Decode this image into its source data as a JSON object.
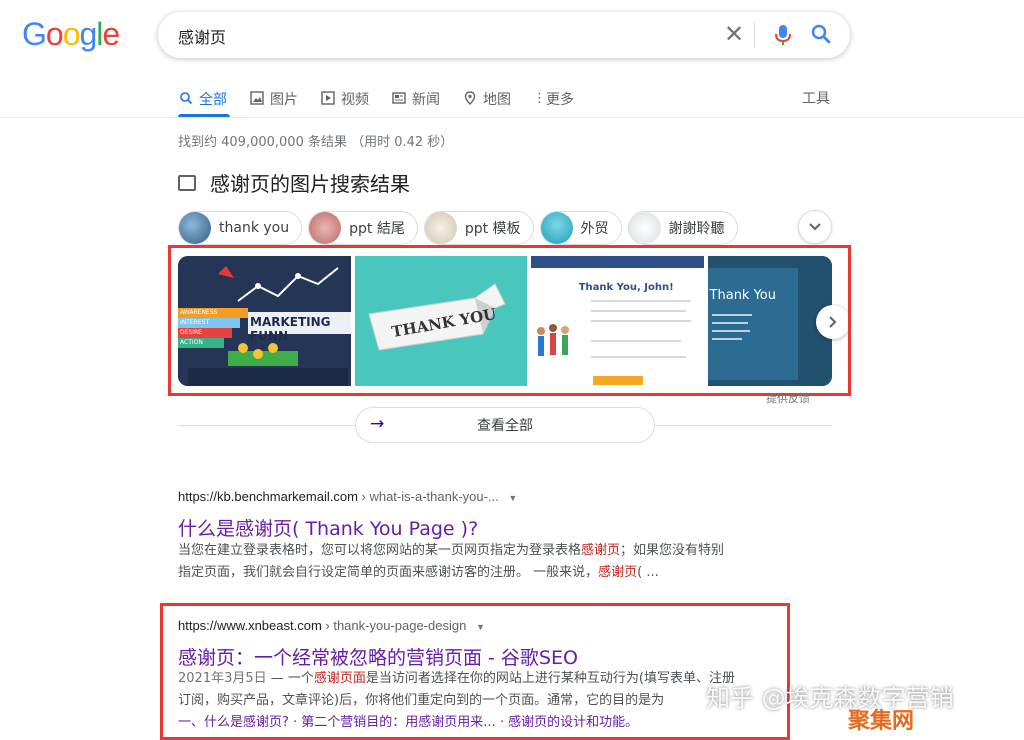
{
  "logo": {
    "text": "Google",
    "letters": [
      "G",
      "o",
      "o",
      "g",
      "l",
      "e"
    ],
    "colors": [
      "#4285F4",
      "#EA4335",
      "#FBBC05",
      "#4285F4",
      "#34A853",
      "#EA4335"
    ]
  },
  "search": {
    "query": "感谢页"
  },
  "tabs": [
    {
      "label": "全部",
      "icon": "search-icon"
    },
    {
      "label": "图片",
      "icon": "image-icon"
    },
    {
      "label": "视频",
      "icon": "play-icon"
    },
    {
      "label": "新闻",
      "icon": "news-icon"
    },
    {
      "label": "地图",
      "icon": "map-pin-icon"
    },
    {
      "label": "更多",
      "icon": "more-vert-icon"
    }
  ],
  "tools_label": "工具",
  "stats": "找到约 409,000,000 条结果 （用时 0.42 秒）",
  "image_section": {
    "heading": "感谢页的图片搜索结果",
    "chips": [
      "thank you",
      "ppt 結尾",
      "ppt 模板",
      "外贸",
      "謝謝聆聽"
    ],
    "tiles": [
      {
        "caption": "MARKETING FUNN",
        "labels": [
          "AWARENESS",
          "INTEREST",
          "DESIRE",
          "ACTION"
        ]
      },
      {
        "caption": "THANK YOU"
      },
      {
        "caption": "Thank You, John!"
      },
      {
        "caption": "Thank You"
      }
    ],
    "feedback": "提供反馈",
    "view_all": "查看全部"
  },
  "results": [
    {
      "url": "https://kb.benchmarkemail.com",
      "path": " › what-is-a-thank-you-...",
      "title": "什么是感谢页( Thank You Page )?",
      "snippet_1a": "当您在建立登录表格时，您可以将您网站的某一页网页指定为登录表格",
      "snippet_1b": "感谢页",
      "snippet_1c": "；如果您没有特别",
      "snippet_2a": "指定页面，我们就会自行设定简单的页面来感谢访客的注册。 一般来说，",
      "snippet_2b": "感谢页",
      "snippet_2c": "( ..."
    },
    {
      "url": "https://www.xnbeast.com",
      "path": " › thank-you-page-design",
      "title": "感谢页：一个经常被忽略的营销页面 - 谷歌SEO",
      "date": "2021年3月5日",
      "snippet_1a": " — 一个",
      "snippet_1b": "感谢页面",
      "snippet_1c": "是当访问者选择在你的网站上进行某种互动行为(填写表单、注册",
      "snippet_2": "订阅，购买产品，文章评论)后，你将他们重定向到的一个页面。通常，它的目的是为",
      "sitelinks": "一、什么是感谢页? · 第二个营销目的：用感谢页用来... · 感谢页的设计和功能。"
    }
  ],
  "watermark": {
    "line1": "知乎 @埃克森数字营销",
    "line2": "聚集网"
  }
}
